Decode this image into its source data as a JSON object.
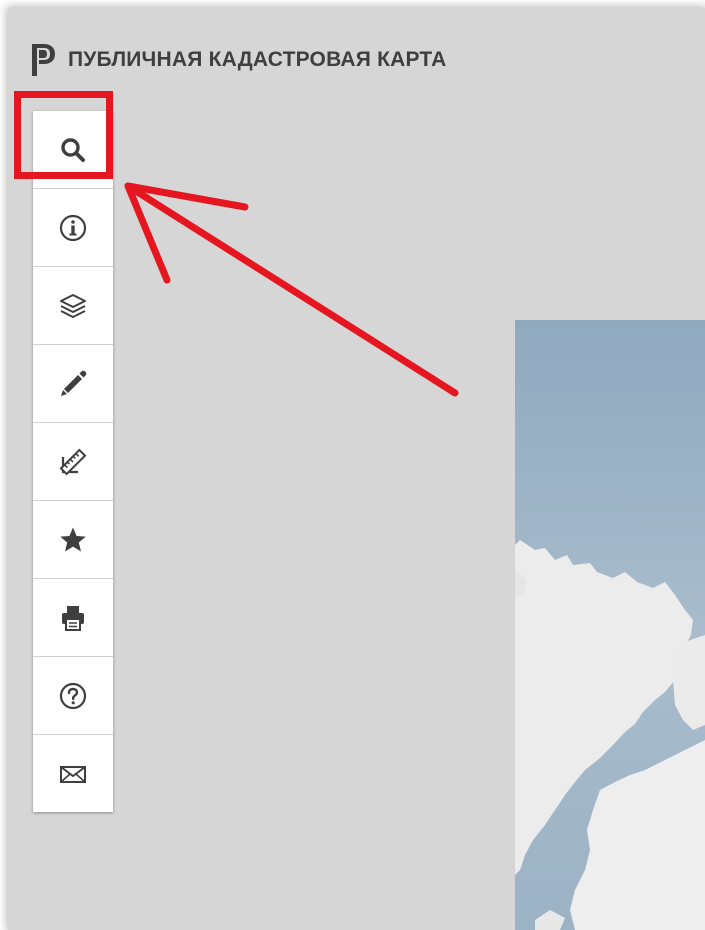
{
  "header": {
    "title": "ПУБЛИЧНАЯ КАДАСТРОВАЯ КАРТА",
    "logo_icon": "pkk-logo-icon"
  },
  "toolbar": {
    "items": [
      {
        "id": "search",
        "icon": "search-icon",
        "highlighted": true
      },
      {
        "id": "info",
        "icon": "info-icon"
      },
      {
        "id": "layers",
        "icon": "layers-icon"
      },
      {
        "id": "draw",
        "icon": "pencil-icon"
      },
      {
        "id": "measure",
        "icon": "ruler-icon"
      },
      {
        "id": "favorites",
        "icon": "star-icon"
      },
      {
        "id": "print",
        "icon": "printer-icon"
      },
      {
        "id": "help",
        "icon": "help-icon"
      },
      {
        "id": "feedback",
        "icon": "envelope-icon"
      }
    ]
  },
  "colors": {
    "background": "#d6d6d6",
    "toolbar_bg": "#ffffff",
    "icon": "#3f3f3f",
    "annotation": "#e5161f",
    "map_water": "#9fb6c8",
    "map_land": "#eeeeee"
  }
}
